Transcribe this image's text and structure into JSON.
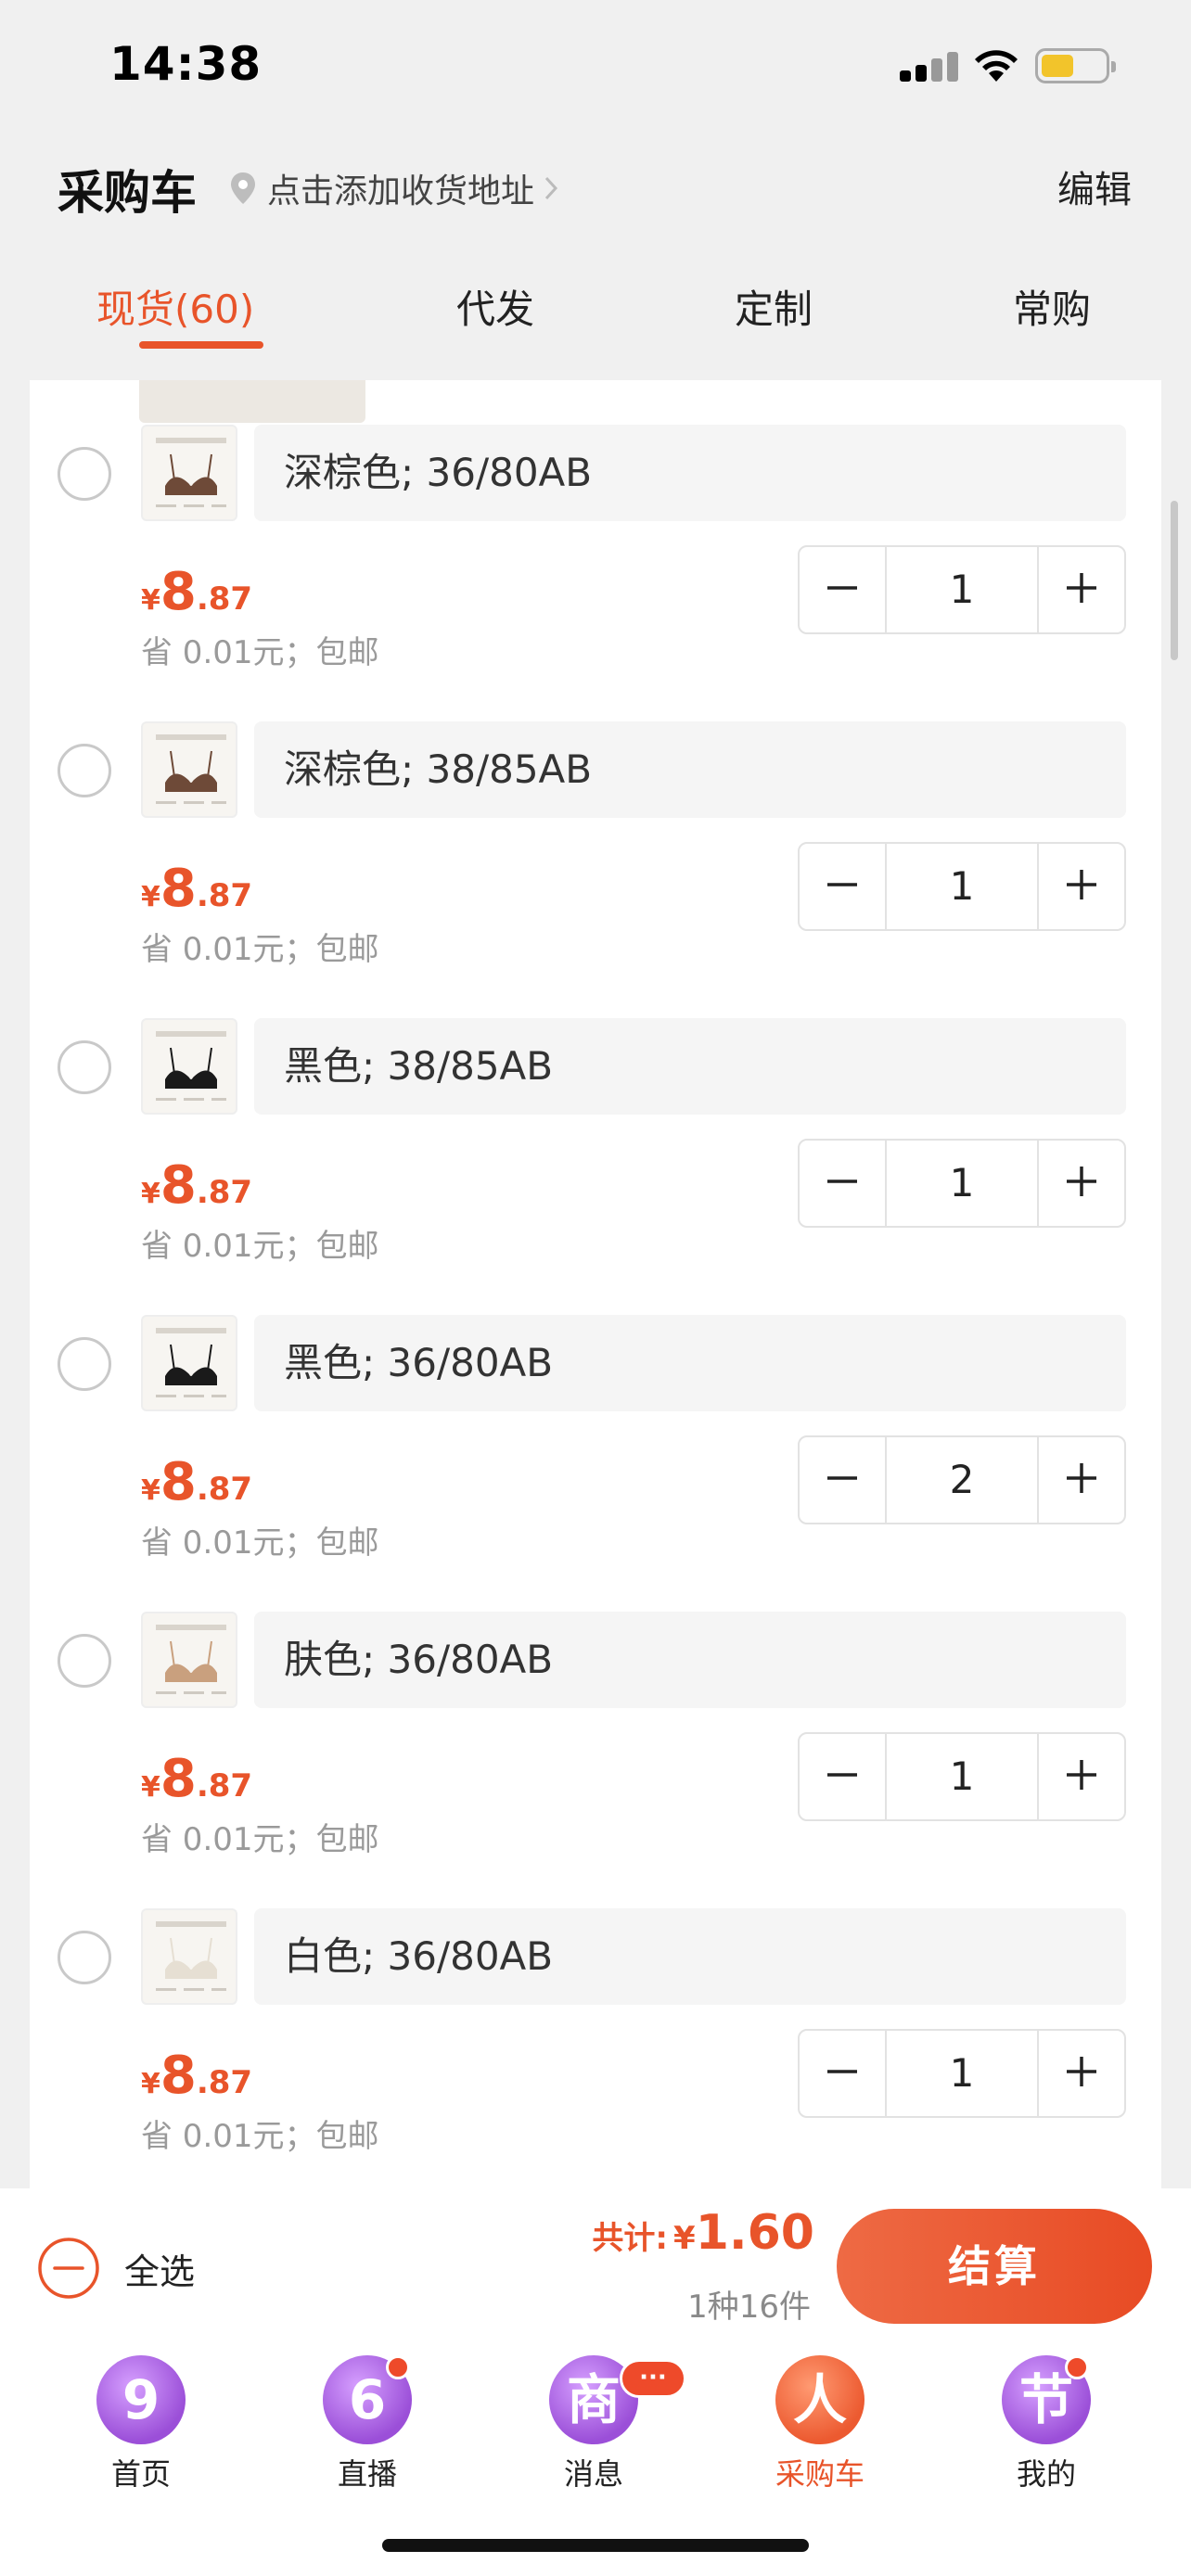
{
  "status_bar": {
    "time": "14:38"
  },
  "header": {
    "title": "采购车",
    "address_prompt": "点击添加收货地址",
    "edit_label": "编辑"
  },
  "tabs": [
    {
      "label": "现货(60)",
      "active": true
    },
    {
      "label": "代发",
      "active": false
    },
    {
      "label": "定制",
      "active": false
    },
    {
      "label": "常购",
      "active": false
    }
  ],
  "items": [
    {
      "variant": "深棕色; 36/80AB",
      "price_symbol": "¥",
      "price_int": "8",
      "price_dec": ".87",
      "note": "省 0.01元；包邮",
      "qty": "1",
      "product_color": "#6e4a38"
    },
    {
      "variant": "深棕色; 38/85AB",
      "price_symbol": "¥",
      "price_int": "8",
      "price_dec": ".87",
      "note": "省 0.01元；包邮",
      "qty": "1",
      "product_color": "#6e4a38"
    },
    {
      "variant": "黑色; 38/85AB",
      "price_symbol": "¥",
      "price_int": "8",
      "price_dec": ".87",
      "note": "省 0.01元；包邮",
      "qty": "1",
      "product_color": "#1a1a1a"
    },
    {
      "variant": "黑色; 36/80AB",
      "price_symbol": "¥",
      "price_int": "8",
      "price_dec": ".87",
      "note": "省 0.01元；包邮",
      "qty": "2",
      "product_color": "#1a1a1a"
    },
    {
      "variant": "肤色; 36/80AB",
      "price_symbol": "¥",
      "price_int": "8",
      "price_dec": ".87",
      "note": "省 0.01元；包邮",
      "qty": "1",
      "product_color": "#c9a07e"
    },
    {
      "variant": "白色; 36/80AB",
      "price_symbol": "¥",
      "price_int": "8",
      "price_dec": ".87",
      "note": "省 0.01元；包邮",
      "qty": "1",
      "product_color": "#e6dfd3"
    }
  ],
  "summary": {
    "select_all_label": "全选",
    "total_label": "共计:",
    "total_symbol": "¥",
    "total_amount": "1.60",
    "count_text": "1种16件",
    "checkout_label": "结算"
  },
  "tabbar": [
    {
      "glyph": "9",
      "label": "首页",
      "active": false,
      "badge": "none"
    },
    {
      "glyph": "6",
      "label": "直播",
      "active": false,
      "badge": "dot"
    },
    {
      "glyph": "商",
      "label": "消息",
      "active": false,
      "badge": "more",
      "badge_text": "···"
    },
    {
      "glyph": "人",
      "label": "采购车",
      "active": true,
      "badge": "none"
    },
    {
      "glyph": "节",
      "label": "我的",
      "active": false,
      "badge": "dot"
    }
  ],
  "colors": {
    "accent": "#e8542a",
    "nav_purple": "#9b4fd8",
    "nav_active": "#ec5a30"
  }
}
